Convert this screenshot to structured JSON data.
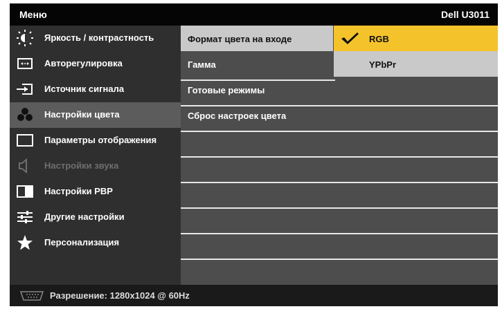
{
  "header": {
    "menu_label": "Меню",
    "model": "Dell U3011"
  },
  "left_menu": [
    {
      "label": "Яркость / контрастность",
      "icon": "brightness-icon"
    },
    {
      "label": "Авторегулировка",
      "icon": "auto-adjust-icon"
    },
    {
      "label": "Источник сигнала",
      "icon": "input-source-icon"
    },
    {
      "label": "Настройки цвета",
      "icon": "color-settings-icon",
      "selected": true
    },
    {
      "label": "Параметры отображения",
      "icon": "display-settings-icon"
    },
    {
      "label": "Настройки звука",
      "icon": "speaker-icon",
      "disabled": true
    },
    {
      "label": "Настройки PBP",
      "icon": "pbp-icon"
    },
    {
      "label": "Другие настройки",
      "icon": "other-settings-icon"
    },
    {
      "label": "Персонализация",
      "icon": "star-icon"
    }
  ],
  "color_menu": [
    {
      "label": "Формат цвета на входе",
      "selected": true
    },
    {
      "label": "Гамма"
    },
    {
      "label": "Готовые режимы"
    },
    {
      "label": "Сброс настроек цвета"
    }
  ],
  "submenu": [
    {
      "label": "RGB",
      "selected": true
    },
    {
      "label": "YPbPr"
    }
  ],
  "status": {
    "text": "Разрешение: 1280x1024 @ 60Hz",
    "icon": "vga-connector-icon"
  },
  "colors": {
    "highlight": "#f4c32c",
    "selected_left": "#5c5c5c",
    "mid_bg": "#4d4d4d"
  }
}
